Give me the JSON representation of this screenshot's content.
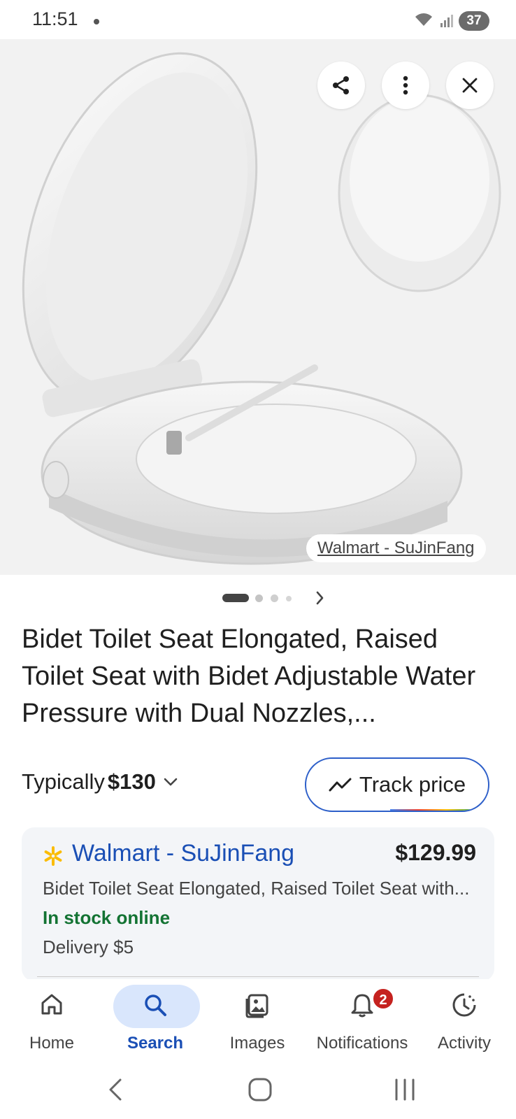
{
  "status_bar": {
    "time": "11:51",
    "battery": "37"
  },
  "hero": {
    "source_chip": "Walmart - SuJinFang",
    "image_alt": "Bidet toilet seat product image"
  },
  "pager": {
    "total": 4,
    "active": 1
  },
  "product": {
    "title": "Bidet Toilet Seat Elongated, Raised Toilet Seat with Bidet Adjustable Water Pressure with Dual Nozzles,..."
  },
  "price_row": {
    "typically_label": "Typically",
    "typically_value": "$130",
    "track_price_label": "Track price"
  },
  "merchant_card": {
    "merchant_name": "Walmart - SuJinFang",
    "price": "$129.99",
    "description": "Bidet Toilet Seat Elongated, Raised Toilet Seat with...",
    "stock": "In stock online",
    "delivery": "Delivery $5",
    "colors": {
      "stock": "#137333",
      "merchant_link": "#1a4fb5",
      "walmart_spark": "#fbbc05"
    }
  },
  "bottom_nav": {
    "items": [
      {
        "label": "Home",
        "icon": "home-icon"
      },
      {
        "label": "Search",
        "icon": "search-icon"
      },
      {
        "label": "Images",
        "icon": "images-icon"
      },
      {
        "label": "Notifications",
        "icon": "bell-icon",
        "badge": "2"
      },
      {
        "label": "Activity",
        "icon": "activity-icon"
      }
    ],
    "active_index": 1
  },
  "system_nav": {
    "icons": [
      "back-icon",
      "home-circle-icon",
      "recents-icon"
    ]
  }
}
